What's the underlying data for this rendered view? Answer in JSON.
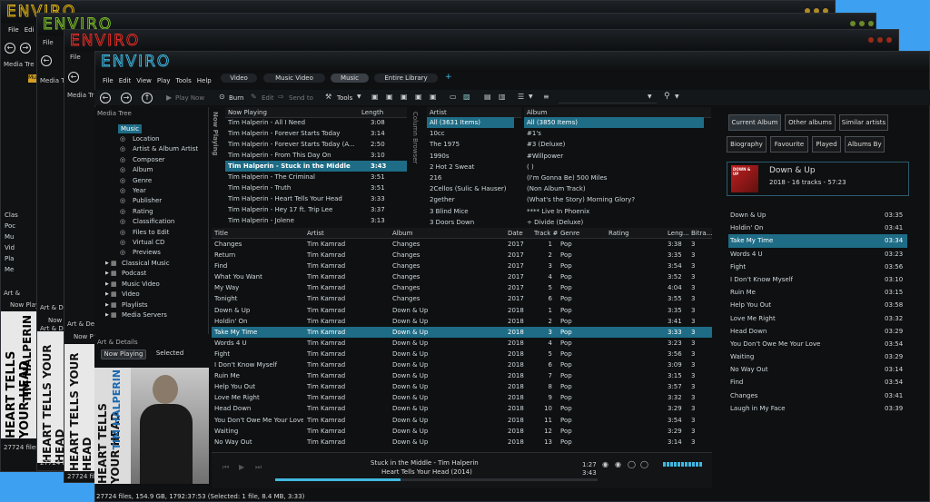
{
  "app": {
    "logo": "ENVIRO"
  },
  "menu": [
    "File",
    "Edit",
    "View",
    "Play",
    "Tools",
    "Help"
  ],
  "back_menu": [
    "File",
    "Edi"
  ],
  "back": {
    "w1_lbl": "Media Tre",
    "w2_lbl": "Media T",
    "w3_lbl": "Media Tr",
    "w1_items": [
      "Clas",
      "Poc",
      "Mu",
      "Vid",
      "Pla",
      "Me"
    ],
    "w1_art": "Art &",
    "w1_np": "Now Play",
    "w2_np": "Now",
    "w3_np": "Now P",
    "w2_art": "Art & D",
    "w3_art": "Art & De",
    "w2_art2": "Art & De",
    "w1_status": "27724 files,",
    "w2_status": "27724 files, 1",
    "w3_status": "27724 files, 154",
    "mu": "Mu",
    "art_text_1": "HEART TELLS YOUR HEAD",
    "art_text_2": "TIM HALPERIN"
  },
  "tabs": [
    "Video",
    "Music Video",
    "Music",
    "Entire Library"
  ],
  "toolbar": {
    "play_now": "Play Now",
    "burn": "Burn",
    "edit": "Edit",
    "send_to": "Send to",
    "tools": "Tools"
  },
  "media_tree": {
    "title": "Media Tree",
    "root": "Music",
    "items": [
      "Location",
      "Artist & Album Artist",
      "Composer",
      "Album",
      "Genre",
      "Year",
      "Publisher",
      "Rating",
      "Classification",
      "Files to Edit",
      "Virtual CD",
      "Previews"
    ],
    "others": [
      "Classical Music",
      "Podcast",
      "Music Video",
      "Video",
      "Playlists",
      "Media Servers"
    ]
  },
  "art_details": {
    "title": "Art & Details",
    "tab_now": "Now Playing",
    "tab_sel": "Selected"
  },
  "now_playing": {
    "header": "Now Playing",
    "length": "Length",
    "side": "Now Playing",
    "rows": [
      [
        "Tim Halperin - All I Need",
        "3:08"
      ],
      [
        "Tim Halperin - Forever Starts Today",
        "3:14"
      ],
      [
        "Tim Halperin - Forever Starts Today (A...",
        "2:50"
      ],
      [
        "Tim Halperin - From This Day On",
        "3:10"
      ],
      [
        "Tim Halperin - Stuck in the Middle",
        "3:43"
      ],
      [
        "Tim Halperin - The Criminal",
        "3:51"
      ],
      [
        "Tim Halperin - Truth",
        "3:51"
      ],
      [
        "Tim Halperin - Heart Tells Your Head",
        "3:33"
      ],
      [
        "Tim Halperin - Hey 17 ft. Trip Lee",
        "3:37"
      ],
      [
        "Tim Halperin - Jolene",
        "3:13"
      ]
    ]
  },
  "column_browser": {
    "side": "Column Browser",
    "artist_header": "Artist",
    "album_header": "Album",
    "artists": [
      "All (3631 Items)",
      "10cc",
      "The 1975",
      "1990s",
      "2 Hot 2 Sweat",
      "216",
      "2Cellos (Sulic & Hauser)",
      "2gether",
      "3 Blind Mice",
      "3 Doors Down"
    ],
    "albums": [
      "All (3850 Items)",
      "#1's",
      "#3 (Deluxe)",
      "#Willpower",
      "( )",
      "(I'm Gonna Be) 500 Miles",
      "(Non Album Track)",
      "(What's the Story) Morning Glory?",
      "**** Live In Phoenix",
      "÷ Divide (Deluxe)"
    ]
  },
  "tracks": {
    "headers": [
      "Title",
      "Artist",
      "Album",
      "Date",
      "Track #",
      "Genre",
      "Rating",
      "Leng...",
      "Bitra..."
    ],
    "rows": [
      [
        "Changes",
        "Tim Kamrad",
        "Changes",
        "2017",
        "1",
        "Pop",
        "3:38",
        "3"
      ],
      [
        "Return",
        "Tim Kamrad",
        "Changes",
        "2017",
        "2",
        "Pop",
        "3:35",
        "3"
      ],
      [
        "Find",
        "Tim Kamrad",
        "Changes",
        "2017",
        "3",
        "Pop",
        "3:54",
        "3"
      ],
      [
        "What You Want",
        "Tim Kamrad",
        "Changes",
        "2017",
        "4",
        "Pop",
        "3:52",
        "3"
      ],
      [
        "My Way",
        "Tim Kamrad",
        "Changes",
        "2017",
        "5",
        "Pop",
        "4:04",
        "3"
      ],
      [
        "Tonight",
        "Tim Kamrad",
        "Changes",
        "2017",
        "6",
        "Pop",
        "3:55",
        "3"
      ],
      [
        "Down & Up",
        "Tim Kamrad",
        "Down & Up",
        "2018",
        "1",
        "Pop",
        "3:35",
        "3"
      ],
      [
        "Holdin' On",
        "Tim Kamrad",
        "Down & Up",
        "2018",
        "2",
        "Pop",
        "3:41",
        "3"
      ],
      [
        "Take My Time",
        "Tim Kamrad",
        "Down & Up",
        "2018",
        "3",
        "Pop",
        "3:33",
        "3"
      ],
      [
        "Words 4 U",
        "Tim Kamrad",
        "Down & Up",
        "2018",
        "4",
        "Pop",
        "3:23",
        "3"
      ],
      [
        "Fight",
        "Tim Kamrad",
        "Down & Up",
        "2018",
        "5",
        "Pop",
        "3:56",
        "3"
      ],
      [
        "I Don't Know Myself",
        "Tim Kamrad",
        "Down & Up",
        "2018",
        "6",
        "Pop",
        "3:09",
        "3"
      ],
      [
        "Ruin Me",
        "Tim Kamrad",
        "Down & Up",
        "2018",
        "7",
        "Pop",
        "3:15",
        "3"
      ],
      [
        "Help You Out",
        "Tim Kamrad",
        "Down & Up",
        "2018",
        "8",
        "Pop",
        "3:57",
        "3"
      ],
      [
        "Love Me Right",
        "Tim Kamrad",
        "Down & Up",
        "2018",
        "9",
        "Pop",
        "3:32",
        "3"
      ],
      [
        "Head Down",
        "Tim Kamrad",
        "Down & Up",
        "2018",
        "10",
        "Pop",
        "3:29",
        "3"
      ],
      [
        "You Don't Owe Me Your Love",
        "Tim Kamrad",
        "Down & Up",
        "2018",
        "11",
        "Pop",
        "3:54",
        "3"
      ],
      [
        "Waiting",
        "Tim Kamrad",
        "Down & Up",
        "2018",
        "12",
        "Pop",
        "3:29",
        "3"
      ],
      [
        "No Way Out",
        "Tim Kamrad",
        "Down & Up",
        "2018",
        "13",
        "Pop",
        "3:14",
        "3"
      ]
    ]
  },
  "player": {
    "title": "Stuck in the Middle - Tim Halperin",
    "album": "Heart Tells Your Head (2014)",
    "elapsed": "1:27",
    "total": "3:43",
    "progress": 0.39
  },
  "status": "27724 files, 154.9 GB, 1792:37:53 (Selected: 1 file, 8.4 MB, 3:33)",
  "right_panel": {
    "buttons": [
      "Current Album",
      "Other albums",
      "Similar artists",
      "Biography",
      "Favourite",
      "Played",
      "Albums By"
    ],
    "album": "Down & Up",
    "info": "2018 - 16 tracks - 57:23",
    "cover_text": "DOWN & UP",
    "tracks": [
      [
        "Down & Up",
        "03:35"
      ],
      [
        "Holdin' On",
        "03:41"
      ],
      [
        "Take My Time",
        "03:34"
      ],
      [
        "Words 4 U",
        "03:23"
      ],
      [
        "Fight",
        "03:56"
      ],
      [
        "I Don't Know Myself",
        "03:10"
      ],
      [
        "Ruin Me",
        "03:15"
      ],
      [
        "Help You Out",
        "03:58"
      ],
      [
        "Love Me Right",
        "03:32"
      ],
      [
        "Head Down",
        "03:29"
      ],
      [
        "You Don't Owe Me Your Love",
        "03:54"
      ],
      [
        "Waiting",
        "03:29"
      ],
      [
        "No Way Out",
        "03:14"
      ],
      [
        "Find",
        "03:54"
      ],
      [
        "Changes",
        "03:41"
      ],
      [
        "Laugh in My Face",
        "03:39"
      ]
    ]
  },
  "colors": {
    "accent": "#1e6c86",
    "logo1": "#e0b21a",
    "logo2": "#7dc030",
    "logo3": "#e0302a",
    "logo4": "#40b8e0"
  }
}
